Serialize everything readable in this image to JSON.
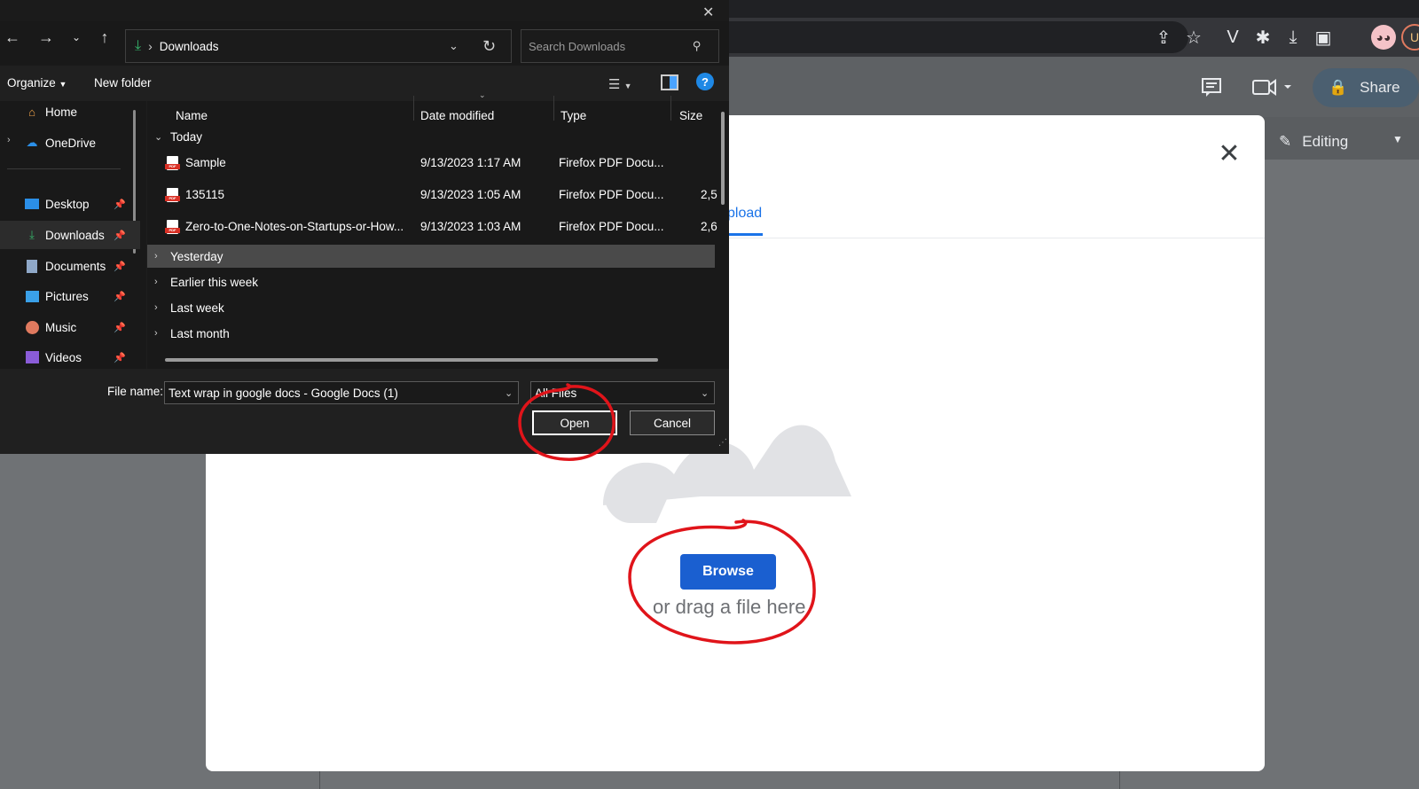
{
  "dialog": {
    "address": "Downloads",
    "search_placeholder": "Search Downloads",
    "commands": {
      "organize": "Organize",
      "new_folder": "New folder"
    },
    "nav_items": [
      {
        "label": "Home",
        "icon": "home-icon",
        "pinned": false
      },
      {
        "label": "OneDrive",
        "icon": "cloud-icon",
        "pinned": false
      },
      {
        "label": "Desktop",
        "icon": "desktop-icon",
        "pinned": true
      },
      {
        "label": "Downloads",
        "icon": "download-icon",
        "pinned": true,
        "selected": true
      },
      {
        "label": "Documents",
        "icon": "document-icon",
        "pinned": true
      },
      {
        "label": "Pictures",
        "icon": "picture-icon",
        "pinned": true
      },
      {
        "label": "Music",
        "icon": "music-icon",
        "pinned": true
      },
      {
        "label": "Videos",
        "icon": "video-icon",
        "pinned": true
      }
    ],
    "columns": {
      "name": "Name",
      "date": "Date modified",
      "type": "Type",
      "size": "Size"
    },
    "groups": {
      "today": "Today",
      "yesterday": "Yesterday",
      "earlier": "Earlier this week",
      "last_week": "Last week",
      "last_month": "Last month"
    },
    "files": [
      {
        "name": "Sample",
        "date": "9/13/2023 1:17 AM",
        "type": "Firefox PDF Docu...",
        "size": ""
      },
      {
        "name": "135115",
        "date": "9/13/2023 1:05 AM",
        "type": "Firefox PDF Docu...",
        "size": "2,5"
      },
      {
        "name": "Zero-to-One-Notes-on-Startups-or-How...",
        "date": "9/13/2023 1:03 AM",
        "type": "Firefox PDF Docu...",
        "size": "2,6"
      }
    ],
    "file_name_label": "File name:",
    "file_name_value": "Text wrap in google docs - Google Docs (1)",
    "file_type": "All Files",
    "open_label": "Open",
    "cancel_label": "Cancel"
  },
  "docs": {
    "share_label": "Share",
    "editing_label": "Editing",
    "avatar_letter": "U"
  },
  "modal": {
    "upload_tab": "pload",
    "browse_label": "Browse",
    "drag_text": "or drag a file here"
  },
  "colors": {
    "accent_blue": "#1a73e8",
    "browse_blue": "#1a5fd0",
    "annotation_red": "#e0141a",
    "dialog_bg": "#1e1e1e"
  }
}
